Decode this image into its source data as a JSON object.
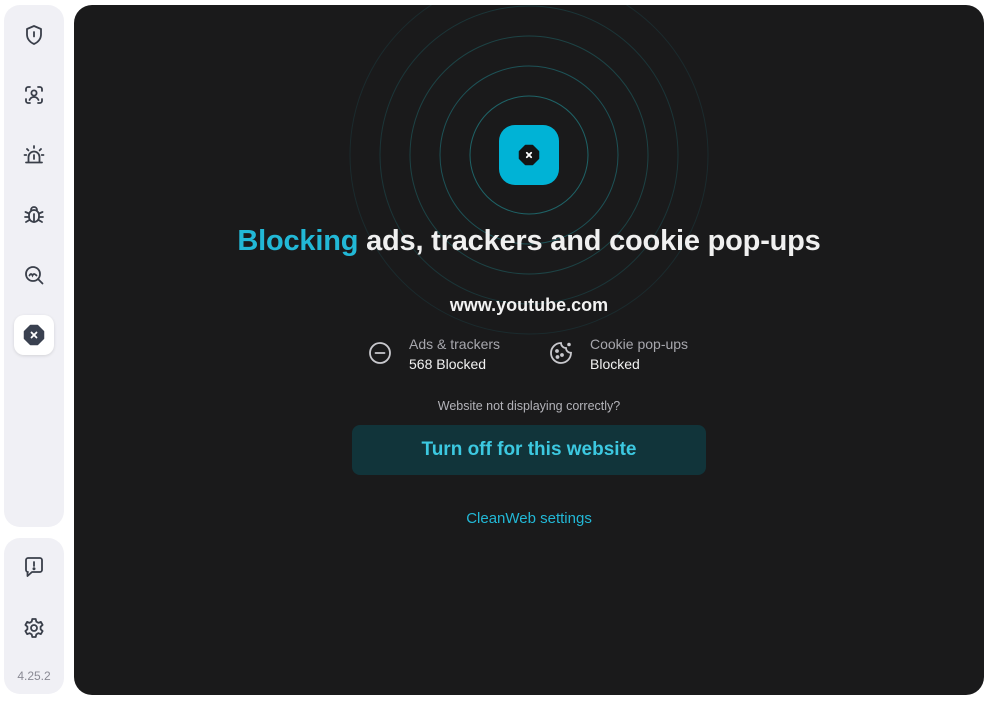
{
  "sidebar": {
    "items": [
      {
        "icon": "shield-icon"
      },
      {
        "icon": "face-scan-icon"
      },
      {
        "icon": "alarm-icon"
      },
      {
        "icon": "bug-icon"
      },
      {
        "icon": "search-dark-web-icon"
      },
      {
        "icon": "cleanweb-icon",
        "active": true
      }
    ],
    "bottom_items": [
      {
        "icon": "feedback-icon"
      },
      {
        "icon": "gear-icon"
      }
    ],
    "version": "4.25.2"
  },
  "main": {
    "title_accent": "Blocking",
    "title_rest": " ads, trackers and cookie pop-ups",
    "site": "www.youtube.com",
    "stats": [
      {
        "label": "Ads & trackers",
        "value": "568 Blocked",
        "icon": "minus-circle-icon"
      },
      {
        "label": "Cookie pop-ups",
        "value": "Blocked",
        "icon": "cookie-icon"
      }
    ],
    "hint": "Website not displaying correctly?",
    "turn_off_label": "Turn off for this website",
    "settings_link": "CleanWeb settings"
  },
  "colors": {
    "accent": "#22b8d6",
    "panel_bg": "#1a1a1b",
    "button_bg": "#11343a",
    "sidebar_bg": "#f0f0f5"
  }
}
